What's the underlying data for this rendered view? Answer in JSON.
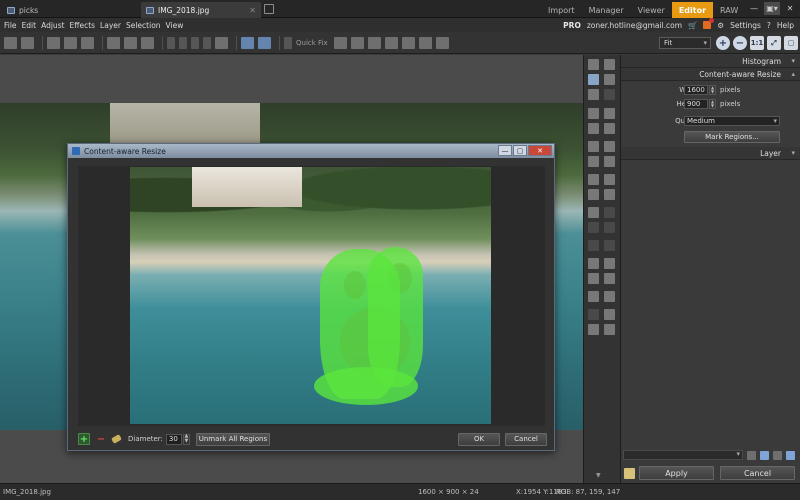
{
  "tabs": [
    {
      "label": "picks",
      "active": false
    },
    {
      "label": "IMG_2018.jpg",
      "active": true
    }
  ],
  "modules": [
    "Import",
    "Manager",
    "Viewer",
    "Editor",
    "RAW"
  ],
  "active_module": "Editor",
  "menu": [
    "File",
    "Edit",
    "Adjust",
    "Effects",
    "Layer",
    "Selection",
    "View"
  ],
  "account": {
    "badge": "PRO",
    "email": "zoner.hotline@gmail.com",
    "settings": "Settings",
    "help": "Help"
  },
  "toolbar": {
    "quick_fix": "Quick Fix",
    "zoom_mode": "Fit"
  },
  "dialog": {
    "title": "Content-aware Resize",
    "diameter_label": "Diameter:",
    "diameter_value": "30",
    "unmark_label": "Unmark All Regions",
    "ok_label": "OK",
    "cancel_label": "Cancel"
  },
  "panel": {
    "histogram": "Histogram",
    "section": "Content-aware Resize",
    "width_label": "Width:",
    "width_value": "1600",
    "height_label": "Height:",
    "height_value": "900",
    "unit": "pixels",
    "quality_label": "Quality:",
    "quality_value": "Medium",
    "mark_regions": "Mark Regions...",
    "layer": "Layer",
    "apply": "Apply",
    "cancel": "Cancel"
  },
  "status": {
    "file": "IMG_2018.jpg",
    "dims": "1600 × 900 × 24",
    "coord": "X:1954 Y:1183",
    "rgb": "RGB: 87, 159, 147"
  },
  "colors": {
    "accent": "#e79a12",
    "mark": "#5ae63c"
  }
}
